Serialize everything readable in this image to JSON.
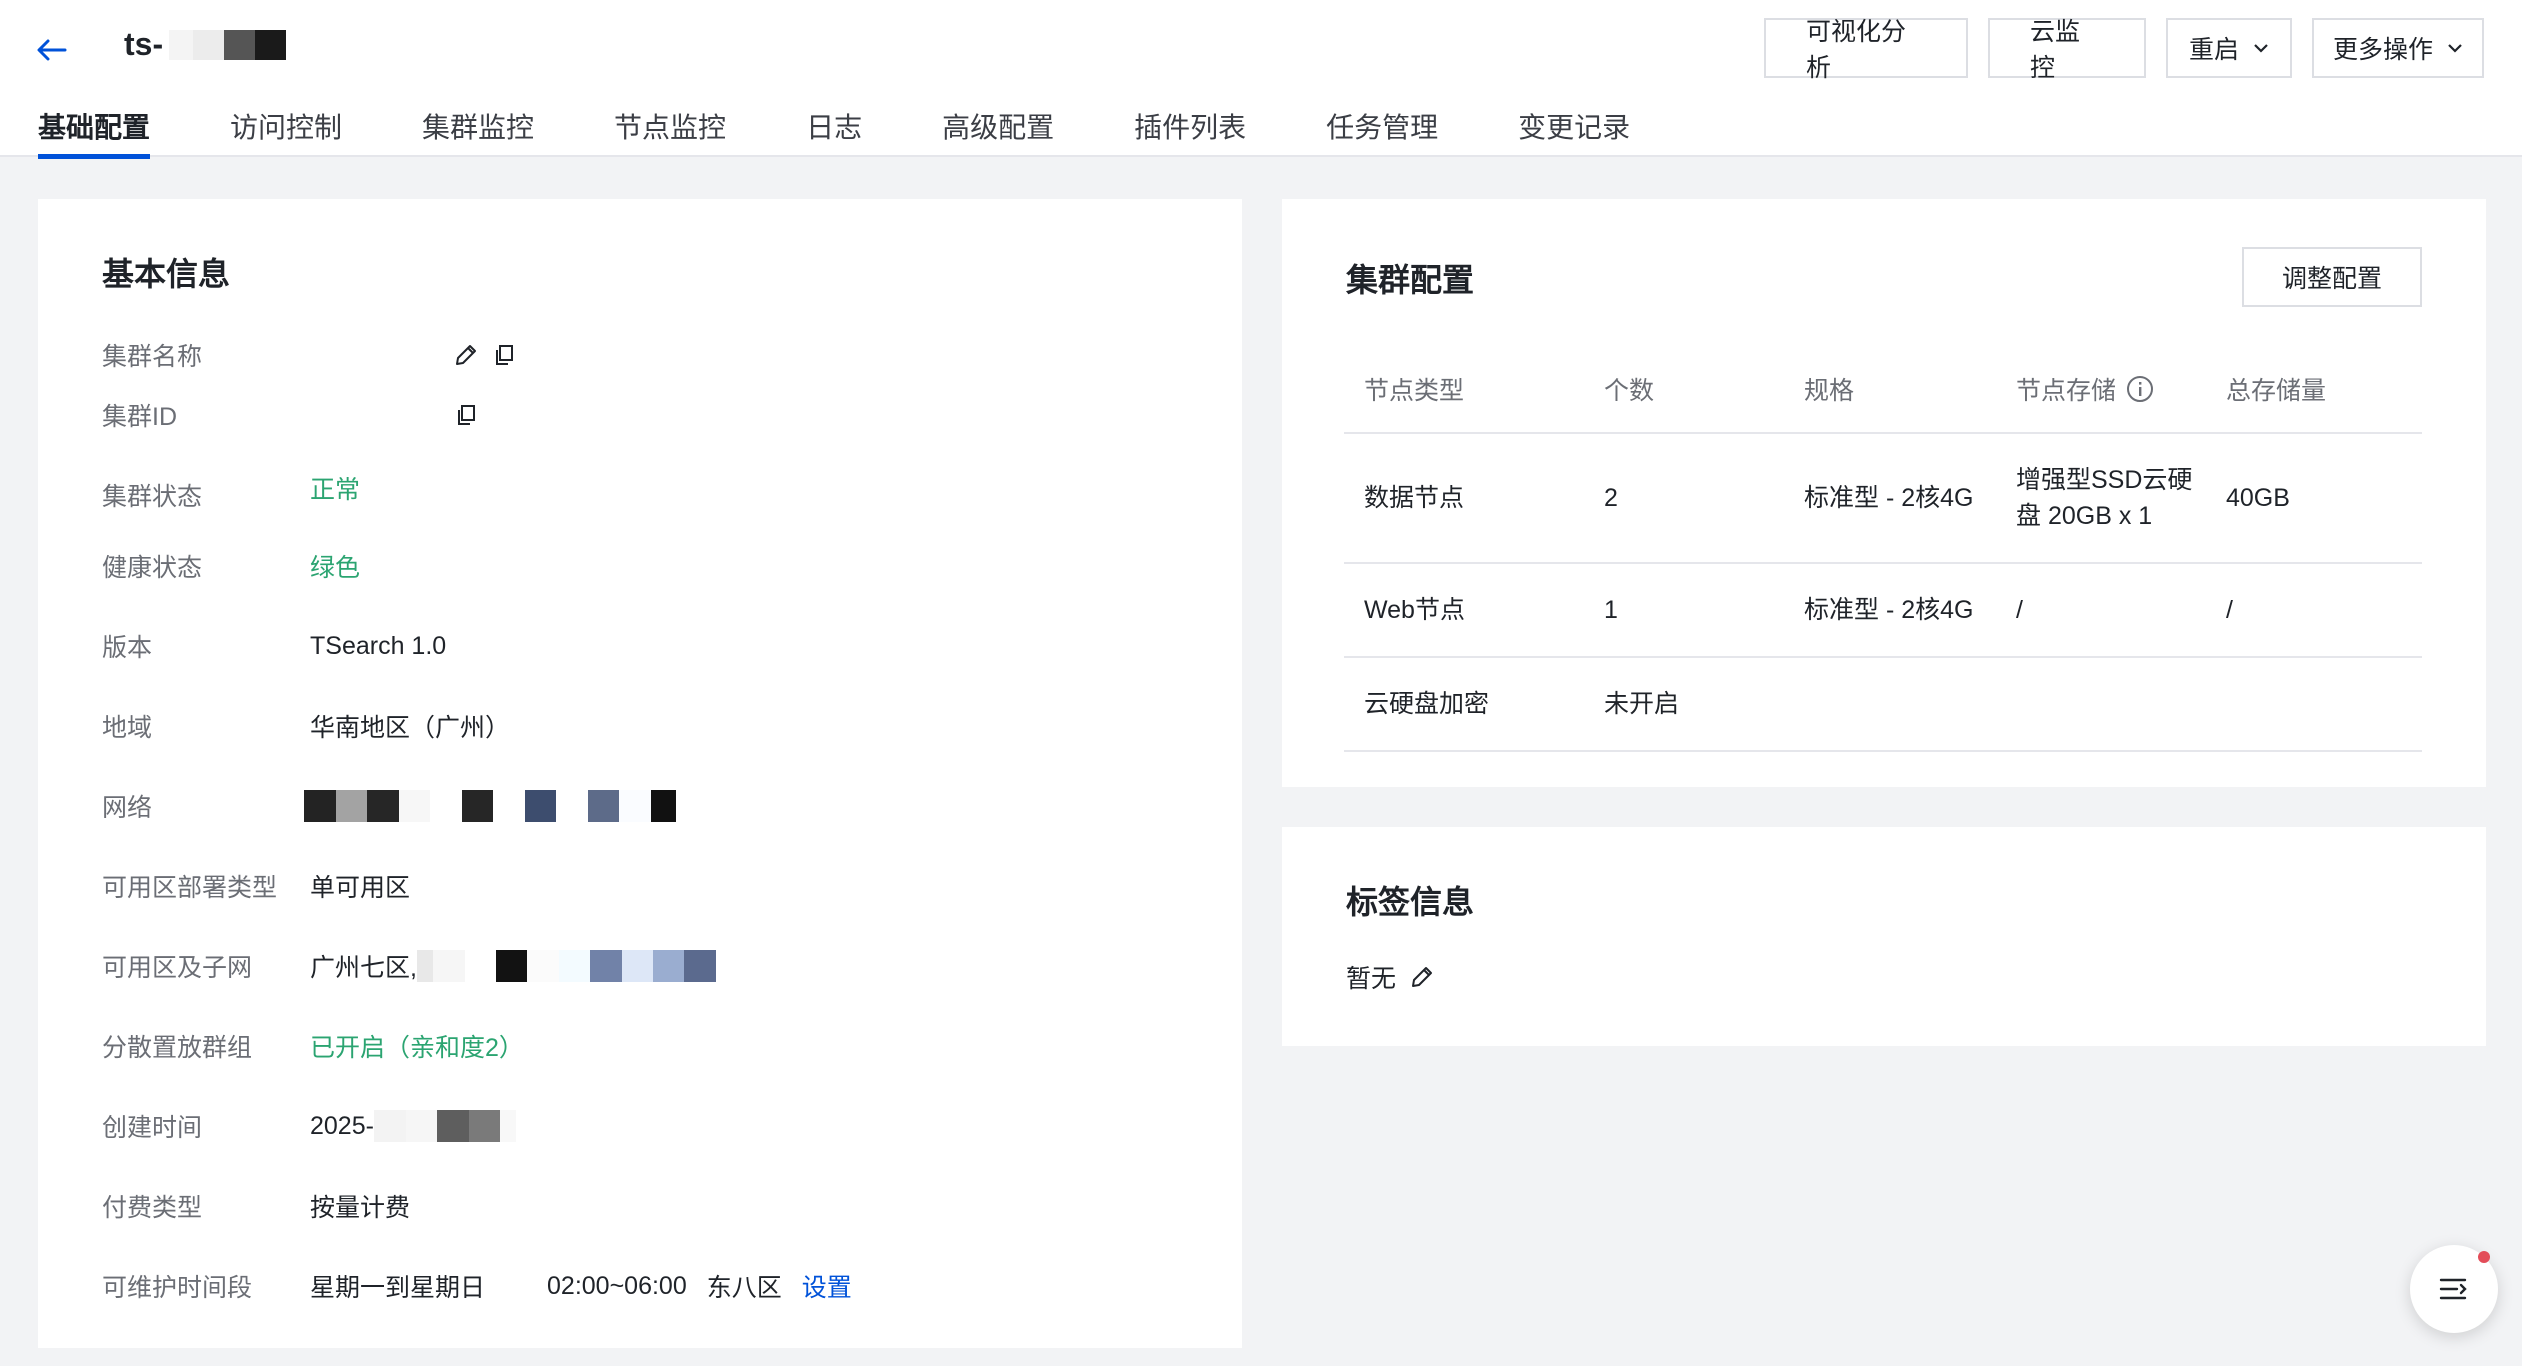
{
  "header": {
    "cluster_name": "ts-",
    "actions": {
      "visual_analysis": "可视化分析",
      "cloud_monitor": "云监控",
      "restart": "重启",
      "more_actions": "更多操作"
    }
  },
  "tabs": [
    {
      "label": "基础配置",
      "active": true
    },
    {
      "label": "访问控制"
    },
    {
      "label": "集群监控"
    },
    {
      "label": "节点监控"
    },
    {
      "label": "日志"
    },
    {
      "label": "高级配置"
    },
    {
      "label": "插件列表"
    },
    {
      "label": "任务管理"
    },
    {
      "label": "变更记录"
    }
  ],
  "basic": {
    "title": "基本信息",
    "rows": {
      "name": {
        "label": "集群名称"
      },
      "id": {
        "label": "集群ID"
      },
      "status": {
        "label": "集群状态",
        "value": "正常"
      },
      "health": {
        "label": "健康状态",
        "value": "绿色"
      },
      "version": {
        "label": "版本",
        "value": "TSearch 1.0"
      },
      "region": {
        "label": "地域",
        "value": "华南地区（广州）"
      },
      "network": {
        "label": "网络"
      },
      "az_type": {
        "label": "可用区部署类型",
        "value": "单可用区"
      },
      "az_subnet": {
        "label": "可用区及子网",
        "value": "广州七区,"
      },
      "placement": {
        "label": "分散置放群组",
        "value": "已开启（亲和度2）"
      },
      "created": {
        "label": "创建时间",
        "value": "2025-"
      },
      "billing": {
        "label": "付费类型",
        "value": "按量计费"
      },
      "maintenance": {
        "label": "可维护时间段",
        "days": "星期一到星期日",
        "time": "02:00~06:00",
        "tz": "东八区",
        "link": "设置"
      }
    }
  },
  "cluster": {
    "title": "集群配置",
    "adjust": "调整配置",
    "columns": [
      "节点类型",
      "个数",
      "规格",
      "节点存储",
      "总存储量"
    ],
    "rows": [
      {
        "type": "数据节点",
        "count": "2",
        "spec": "标准型 - 2核4G",
        "storage_line1": "增强型SSD云硬",
        "storage_line2": "盘 20GB x 1",
        "total": "40GB"
      },
      {
        "type": "Web节点",
        "count": "1",
        "spec": "标准型 - 2核4G",
        "storage": "/",
        "total": "/"
      },
      {
        "type": "云硬盘加密",
        "count": "未开启"
      }
    ]
  },
  "tags": {
    "title": "标签信息",
    "value": "暂无"
  },
  "colors": {
    "accent": "#0052d9",
    "success": "#2ba471",
    "notify": "#e34d59"
  }
}
